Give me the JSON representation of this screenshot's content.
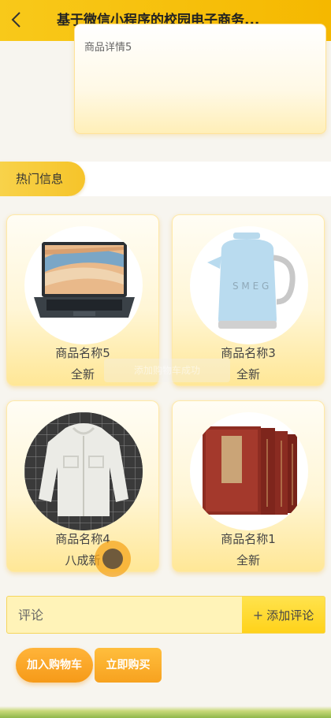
{
  "header": {
    "title": "基于微信小程序的校园电子商务...",
    "back_icon": "chevron-left-icon"
  },
  "detail": {
    "text": "商品详情5"
  },
  "hot_section": {
    "label": "热门信息"
  },
  "products": [
    {
      "name": "商品名称5",
      "condition": "全新",
      "image": "laptop-image"
    },
    {
      "name": "商品名称3",
      "condition": "全新",
      "image": "kettle-image"
    },
    {
      "name": "商品名称4",
      "condition": "八成新",
      "image": "jacket-image"
    },
    {
      "name": "商品名称1",
      "condition": "全新",
      "image": "books-image"
    }
  ],
  "toast": {
    "text": "添加购物车成功"
  },
  "comment": {
    "placeholder": "评论",
    "button_label": "添加评论",
    "button_icon": "plus-icon"
  },
  "actions": {
    "add_to_cart": "加入购物车",
    "buy_now": "立即购买"
  },
  "colors": {
    "primary": "#f8c91a",
    "accent": "#f69a18"
  }
}
